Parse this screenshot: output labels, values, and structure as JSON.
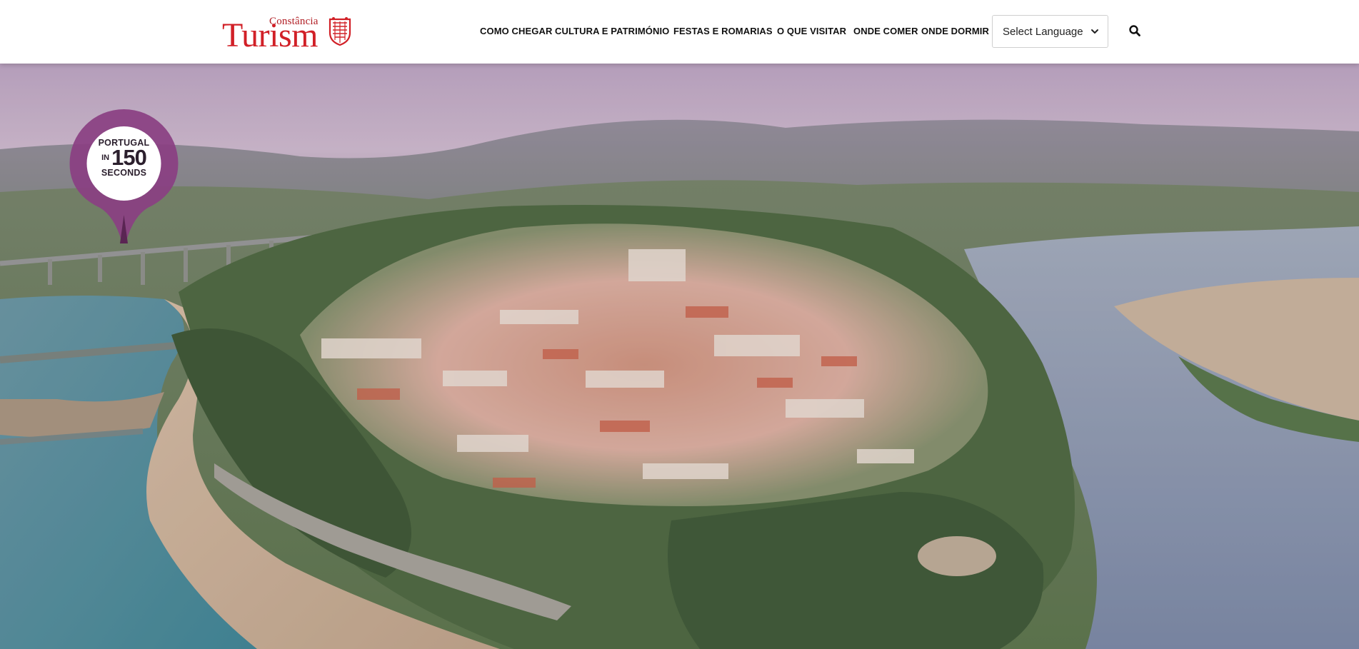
{
  "brand": {
    "logo_small": "Constância",
    "logo_main": "Turism",
    "accent_color": "#d12027"
  },
  "nav": {
    "items": [
      {
        "label": "COMO CHEGAR"
      },
      {
        "label": "CULTURA E PATRIMÓNIO"
      },
      {
        "label": "FESTAS E ROMARIAS"
      },
      {
        "label": "O QUE VISITAR"
      },
      {
        "label": "ONDE COMER"
      },
      {
        "label": "ONDE DORMIR"
      }
    ]
  },
  "language_select": {
    "selected": "Select Language",
    "icon": "chevron-down-icon"
  },
  "search": {
    "icon": "search-icon"
  },
  "hero": {
    "description_icon": "aerial-video-background",
    "badge": {
      "line1": "PORTUGAL",
      "in": "IN",
      "number": "150",
      "line3": "SECONDS",
      "color": "#8a3f82"
    }
  }
}
